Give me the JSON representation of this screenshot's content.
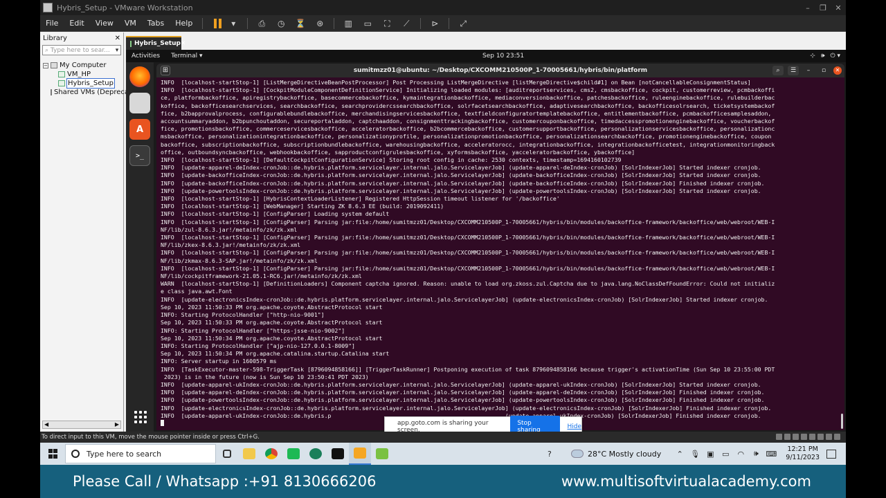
{
  "window": {
    "title": "Hybris_Setup - VMware Workstation",
    "controls": [
      "–",
      "❐",
      "✕"
    ]
  },
  "menubar": {
    "items": [
      "File",
      "Edit",
      "View",
      "VM",
      "Tabs",
      "Help"
    ]
  },
  "library": {
    "title": "Library",
    "close": "✕",
    "search_placeholder": "Type here to sear...",
    "tree": {
      "root": "My Computer",
      "vms": [
        "VM_HP",
        "Hybris_Setup"
      ],
      "shared": "Shared VMs (Depreca"
    }
  },
  "vm_tab": {
    "label": "Hybris_Setup",
    "close": "✕"
  },
  "ubuntu": {
    "activities": "Activities",
    "app_menu": "Terminal ▾",
    "clock": "Sep 10  23:51",
    "tray": [
      "⊹",
      "🕪",
      "⏻ ▾"
    ]
  },
  "terminal": {
    "title": "sumitmzz01@ubuntu: ~/Desktop/CXCOMM210500P_1-70005661/hybris/bin/platform",
    "buttons": [
      "⌕",
      "☰",
      "–",
      "▫",
      "✕"
    ],
    "lines": [
      "INFO  [localhost-startStop-1] [ListMergeDirectiveBeanPostProcessor] Post Processing ListMergeDirective [listMergeDirective$child#1] on Bean [notCancellableConsignmentStatus]",
      "INFO  [localhost-startStop-1] [CockpitModuleComponentDefinitionService] Initializing loaded modules: [auditreportservices, cms2, cmsbackoffice, cockpit, customerreview, pcmbackoffi",
      "ce, platformbackoffice, apiregistrybackoffice, basecommercebackoffice, kymaintegrationbackoffice, mediaconversionbackoffice, patchesbackoffice, ruleenginebackoffice, rulebuilderbac",
      "koffice, backofficesearchservices, searchbackoffice, searchprovidercssearchbackoffice, solrfacetsearchbackoffice, adaptivesearchbackoffice, backofficesolrsearch, ticketsystembackof",
      "fice, b2bapprovalprocess, configurablebundlebackoffice, merchandisingservicesbackoffice, textfieldconfiguratortemplatebackoffice, entitlementbackoffice, pcmbackofficesamplesaddon,",
      "accountsummaryaddon, b2bpunchoutaddon, secureportaladdon, captchaaddon, consignmenttrackingbackoffice, customercouponbackoffice, timedaccesspromotionenginebackoffice, voucherbackof",
      "fice, promotionsbackoffice, commerceservicesbackoffice, acceleratorbackoffice, b2bcommercebackoffice, customersupportbackoffice, personalizationservicesbackoffice, personalizationc",
      "msbackoffice, personalizationintegrationbackoffice, personalizationyprofile, personalizationpromotionbackoffice, personalizationsearchbackoffice, promotionenginebackoffice, coupon",
      "backoffice, subscriptionbackoffice, subscriptionbundlebackoffice, warehousingbackoffice, acceleratorocc, integrationbackoffice, integrationbackofficetest, integrationmonitoringback",
      "office, outboundsyncbackoffice, webhookbackoffice, sapproductconfigrulesbackoffice, xyformsbackoffice, yacceleratorbackoffice, ybackoffice]",
      "INFO  [localhost-startStop-1] [DefaultCockpitConfigurationService] Storing root config in cache: 2530 contexts, timestamp=1694160102739",
      "INFO  [update-apparel-deIndex-cronJob::de.hybris.platform.servicelayer.internal.jalo.ServicelayerJob] (update-apparel-deIndex-cronJob) [SolrIndexerJob] Started indexer cronjob.",
      "INFO  [update-backofficeIndex-cronJob::de.hybris.platform.servicelayer.internal.jalo.ServicelayerJob] (update-backofficeIndex-cronJob) [SolrIndexerJob] Started indexer cronjob.",
      "INFO  [update-backofficeIndex-cronJob::de.hybris.platform.servicelayer.internal.jalo.ServicelayerJob] (update-backofficeIndex-cronJob) [SolrIndexerJob] Finished indexer cronjob.",
      "INFO  [update-powertoolsIndex-cronJob::de.hybris.platform.servicelayer.internal.jalo.ServicelayerJob] (update-powertoolsIndex-cronJob) [SolrIndexerJob] Started indexer cronjob.",
      "INFO  [localhost-startStop-1] [HybrisContextLoaderListener] Registered HttpSession timeout listener for '/backoffice'",
      "INFO  [localhost-startStop-1] [WebManager] Starting ZK 8.6.3 EE (build: 2019092411)",
      "INFO  [localhost-startStop-1] [ConfigParser] Loading system default",
      "INFO  [localhost-startStop-1] [ConfigParser] Parsing jar:file:/home/sumitmzz01/Desktop/CXCOMM210500P_1-70005661/hybris/bin/modules/backoffice-framework/backoffice/web/webroot/WEB-I",
      "NF/lib/zul-8.6.3.jar!/metainfo/zk/zk.xml",
      "INFO  [localhost-startStop-1] [ConfigParser] Parsing jar:file:/home/sumitmzz01/Desktop/CXCOMM210500P_1-70005661/hybris/bin/modules/backoffice-framework/backoffice/web/webroot/WEB-I",
      "NF/lib/zkex-8.6.3.jar!/metainfo/zk/zk.xml",
      "INFO  [localhost-startStop-1] [ConfigParser] Parsing jar:file:/home/sumitmzz01/Desktop/CXCOMM210500P_1-70005661/hybris/bin/modules/backoffice-framework/backoffice/web/webroot/WEB-I",
      "NF/lib/zkmax-8.6.3-SAP.jar!/metainfo/zk/zk.xml",
      "INFO  [localhost-startStop-1] [ConfigParser] Parsing jar:file:/home/sumitmzz01/Desktop/CXCOMM210500P_1-70005661/hybris/bin/modules/backoffice-framework/backoffice/web/webroot/WEB-I",
      "NF/lib/cockpitframework-21.05.1-RC6.jar!/metainfo/zk/zk.xml",
      "WARN  [localhost-startStop-1] [DefinitionLoaders] Component captcha ignored. Reason: unable to load org.zkoss.zul.Captcha due to java.lang.NoClassDefFoundError: Could not initializ",
      "e class java.awt.Font",
      "INFO  [update-electronicsIndex-cronJob::de.hybris.platform.servicelayer.internal.jalo.ServicelayerJob] (update-electronicsIndex-cronJob) [SolrIndexerJob] Started indexer cronjob.",
      "Sep 10, 2023 11:50:33 PM org.apache.coyote.AbstractProtocol start",
      "INFO: Starting ProtocolHandler [\"http-nio-9001\"]",
      "Sep 10, 2023 11:50:33 PM org.apache.coyote.AbstractProtocol start",
      "INFO: Starting ProtocolHandler [\"https-jsse-nio-9002\"]",
      "Sep 10, 2023 11:50:34 PM org.apache.coyote.AbstractProtocol start",
      "INFO: Starting ProtocolHandler [\"ajp-nio-127.0.0.1-8009\"]",
      "Sep 10, 2023 11:50:34 PM org.apache.catalina.startup.Catalina start",
      "INFO: Server startup in 1600579 ms",
      "INFO  [TaskExecutor-master-598-TriggerTask [8796094858166]] [TriggerTaskRunner] Postponing execution of task 8796094858166 because trigger's activationTime (Sun Sep 10 23:55:00 PDT",
      " 2023) is in the future (now is Sun Sep 10 23:50:41 PDT 2023)",
      "INFO  [update-apparel-ukIndex-cronJob::de.hybris.platform.servicelayer.internal.jalo.ServicelayerJob] (update-apparel-ukIndex-cronJob) [SolrIndexerJob] Started indexer cronjob.",
      "INFO  [update-apparel-deIndex-cronJob::de.hybris.platform.servicelayer.internal.jalo.ServicelayerJob] (update-apparel-deIndex-cronJob) [SolrIndexerJob] Finished indexer cronjob.",
      "INFO  [update-powertoolsIndex-cronJob::de.hybris.platform.servicelayer.internal.jalo.ServicelayerJob] (update-powertoolsIndex-cronJob) [SolrIndexerJob] Finished indexer cronjob.",
      "INFO  [update-electronicsIndex-cronJob::de.hybris.platform.servicelayer.internal.jalo.ServicelayerJob] (update-electronicsIndex-cronJob) [SolrIndexerJob] Finished indexer cronjob.",
      "INFO  [update-apparel-ukIndex-cronJob::de.hybris.p                                                   (update-apparel-ukIndex-cronJob) [SolrIndexerJob] Finished indexer cronjob."
    ]
  },
  "share_banner": {
    "message": "app.goto.com is sharing your screen.",
    "stop": "Stop sharing",
    "hide": "Hide"
  },
  "vm_status": {
    "hint": "To direct input to this VM, move the mouse pointer inside or press Ctrl+G."
  },
  "taskbar": {
    "search_placeholder": "Type here to search",
    "weather": "28°C  Mostly cloudy",
    "time": "12:21 PM",
    "date": "9/11/2023"
  },
  "promo": {
    "call": "Please  Call / Whatsapp :+91 8130666206",
    "site": "www.multisoftvirtualacademy.com"
  },
  "colors": {
    "terminal_bg": "#300a24",
    "ubuntu_orange": "#e95420",
    "promo_bg": "#16607d",
    "share_button": "#1572e8"
  }
}
